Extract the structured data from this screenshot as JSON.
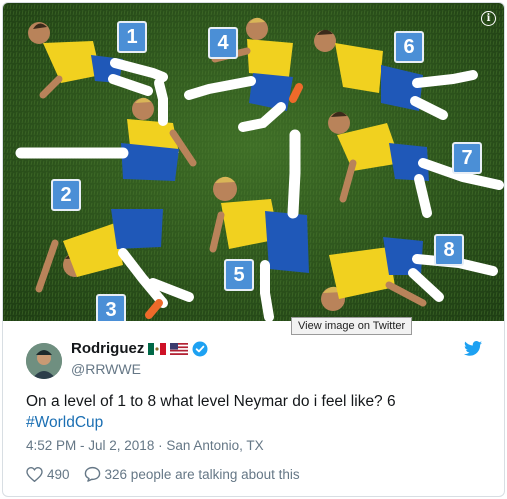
{
  "media": {
    "badges": [
      "1",
      "2",
      "3",
      "4",
      "5",
      "6",
      "7",
      "8"
    ],
    "tooltip": "View image on Twitter",
    "info_icon": "info-icon",
    "colors": {
      "grass": "#2f5a1f",
      "jersey": "#f1d11f",
      "shorts": "#1f58b8",
      "badge": "#4b8fd6",
      "skin": "#b9835a"
    }
  },
  "tweet": {
    "display_name": "Rodriguez",
    "flags": [
      "mexico-flag-icon",
      "usa-flag-icon"
    ],
    "verified_icon": "verified-icon",
    "handle": "@RRWWE",
    "text_main": "On a level of 1 to 8 what level Neymar do i feel like? 6",
    "hashtag": "#WorldCup",
    "timestamp": "4:52 PM - Jul 2, 2018 · San Antonio, TX",
    "like_count": "490",
    "talking": "326 people are talking about this",
    "brand_color": "#1da1f2"
  }
}
